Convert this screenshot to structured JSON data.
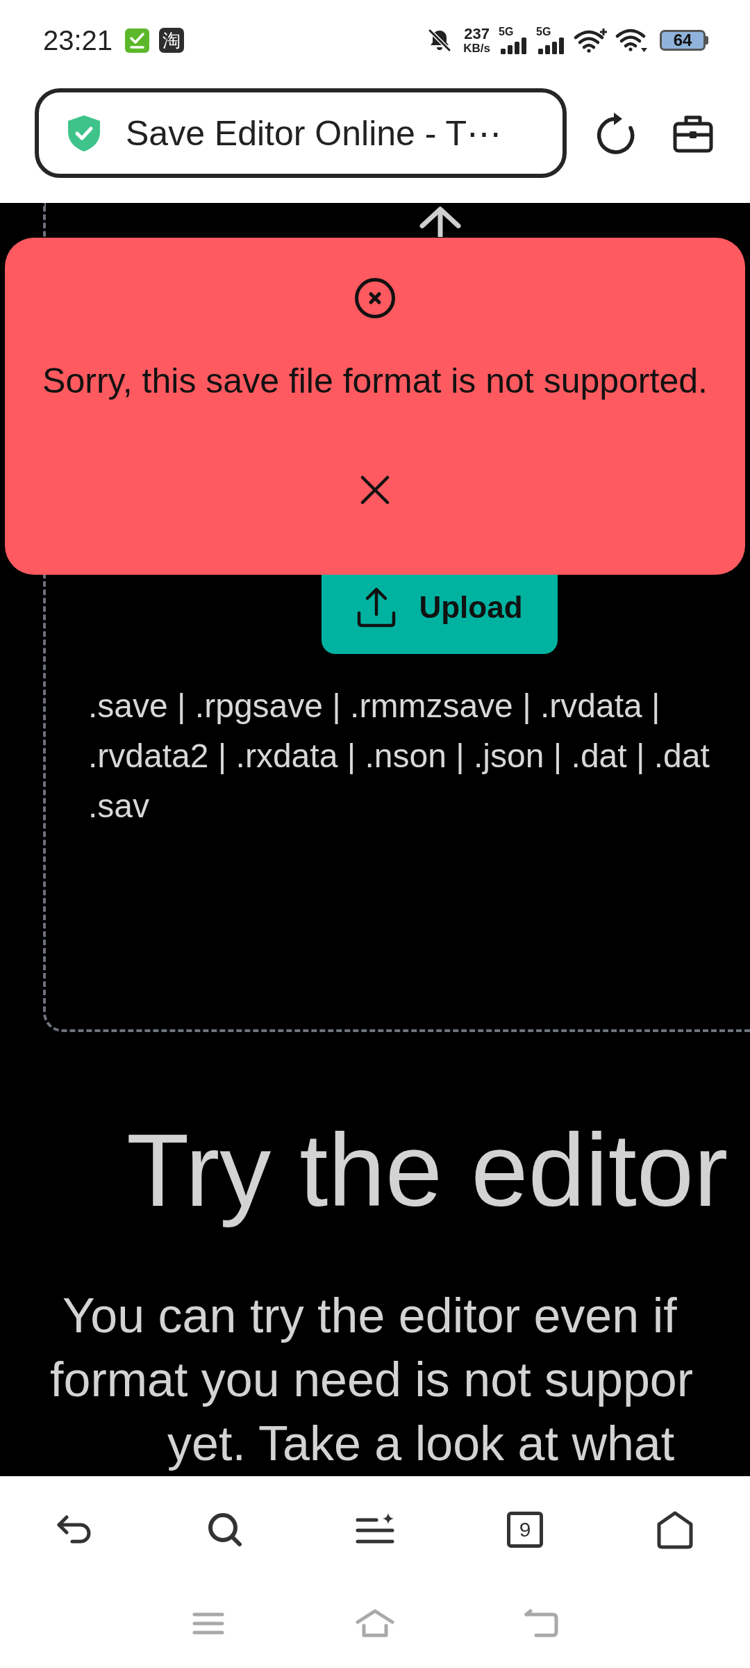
{
  "status_bar": {
    "time": "23:21",
    "app_badge": "淘",
    "speed_value": "237",
    "speed_unit": "KB/s",
    "cellular": [
      {
        "label": "5G"
      },
      {
        "label": "5G"
      }
    ],
    "battery": "64"
  },
  "address_bar": {
    "secure": true,
    "title": "Save Editor Online - T⋯"
  },
  "toast": {
    "message": "Sorry, this save file format is not supported."
  },
  "upload_area": {
    "button_label": "Upload",
    "formats_lines": [
      ".save | .rpgsave | .rmmzsave | .rvdata |",
      ".rvdata2 | .rxdata | .nson | .json | .dat | .dat",
      ".sav"
    ]
  },
  "promo": {
    "heading": "Try the editor",
    "paragraph_lines": [
      "You can try the editor even if",
      "format you need is not suppor",
      "yet. Take a look at what"
    ]
  },
  "toolbar": {
    "tab_count": "9"
  }
}
